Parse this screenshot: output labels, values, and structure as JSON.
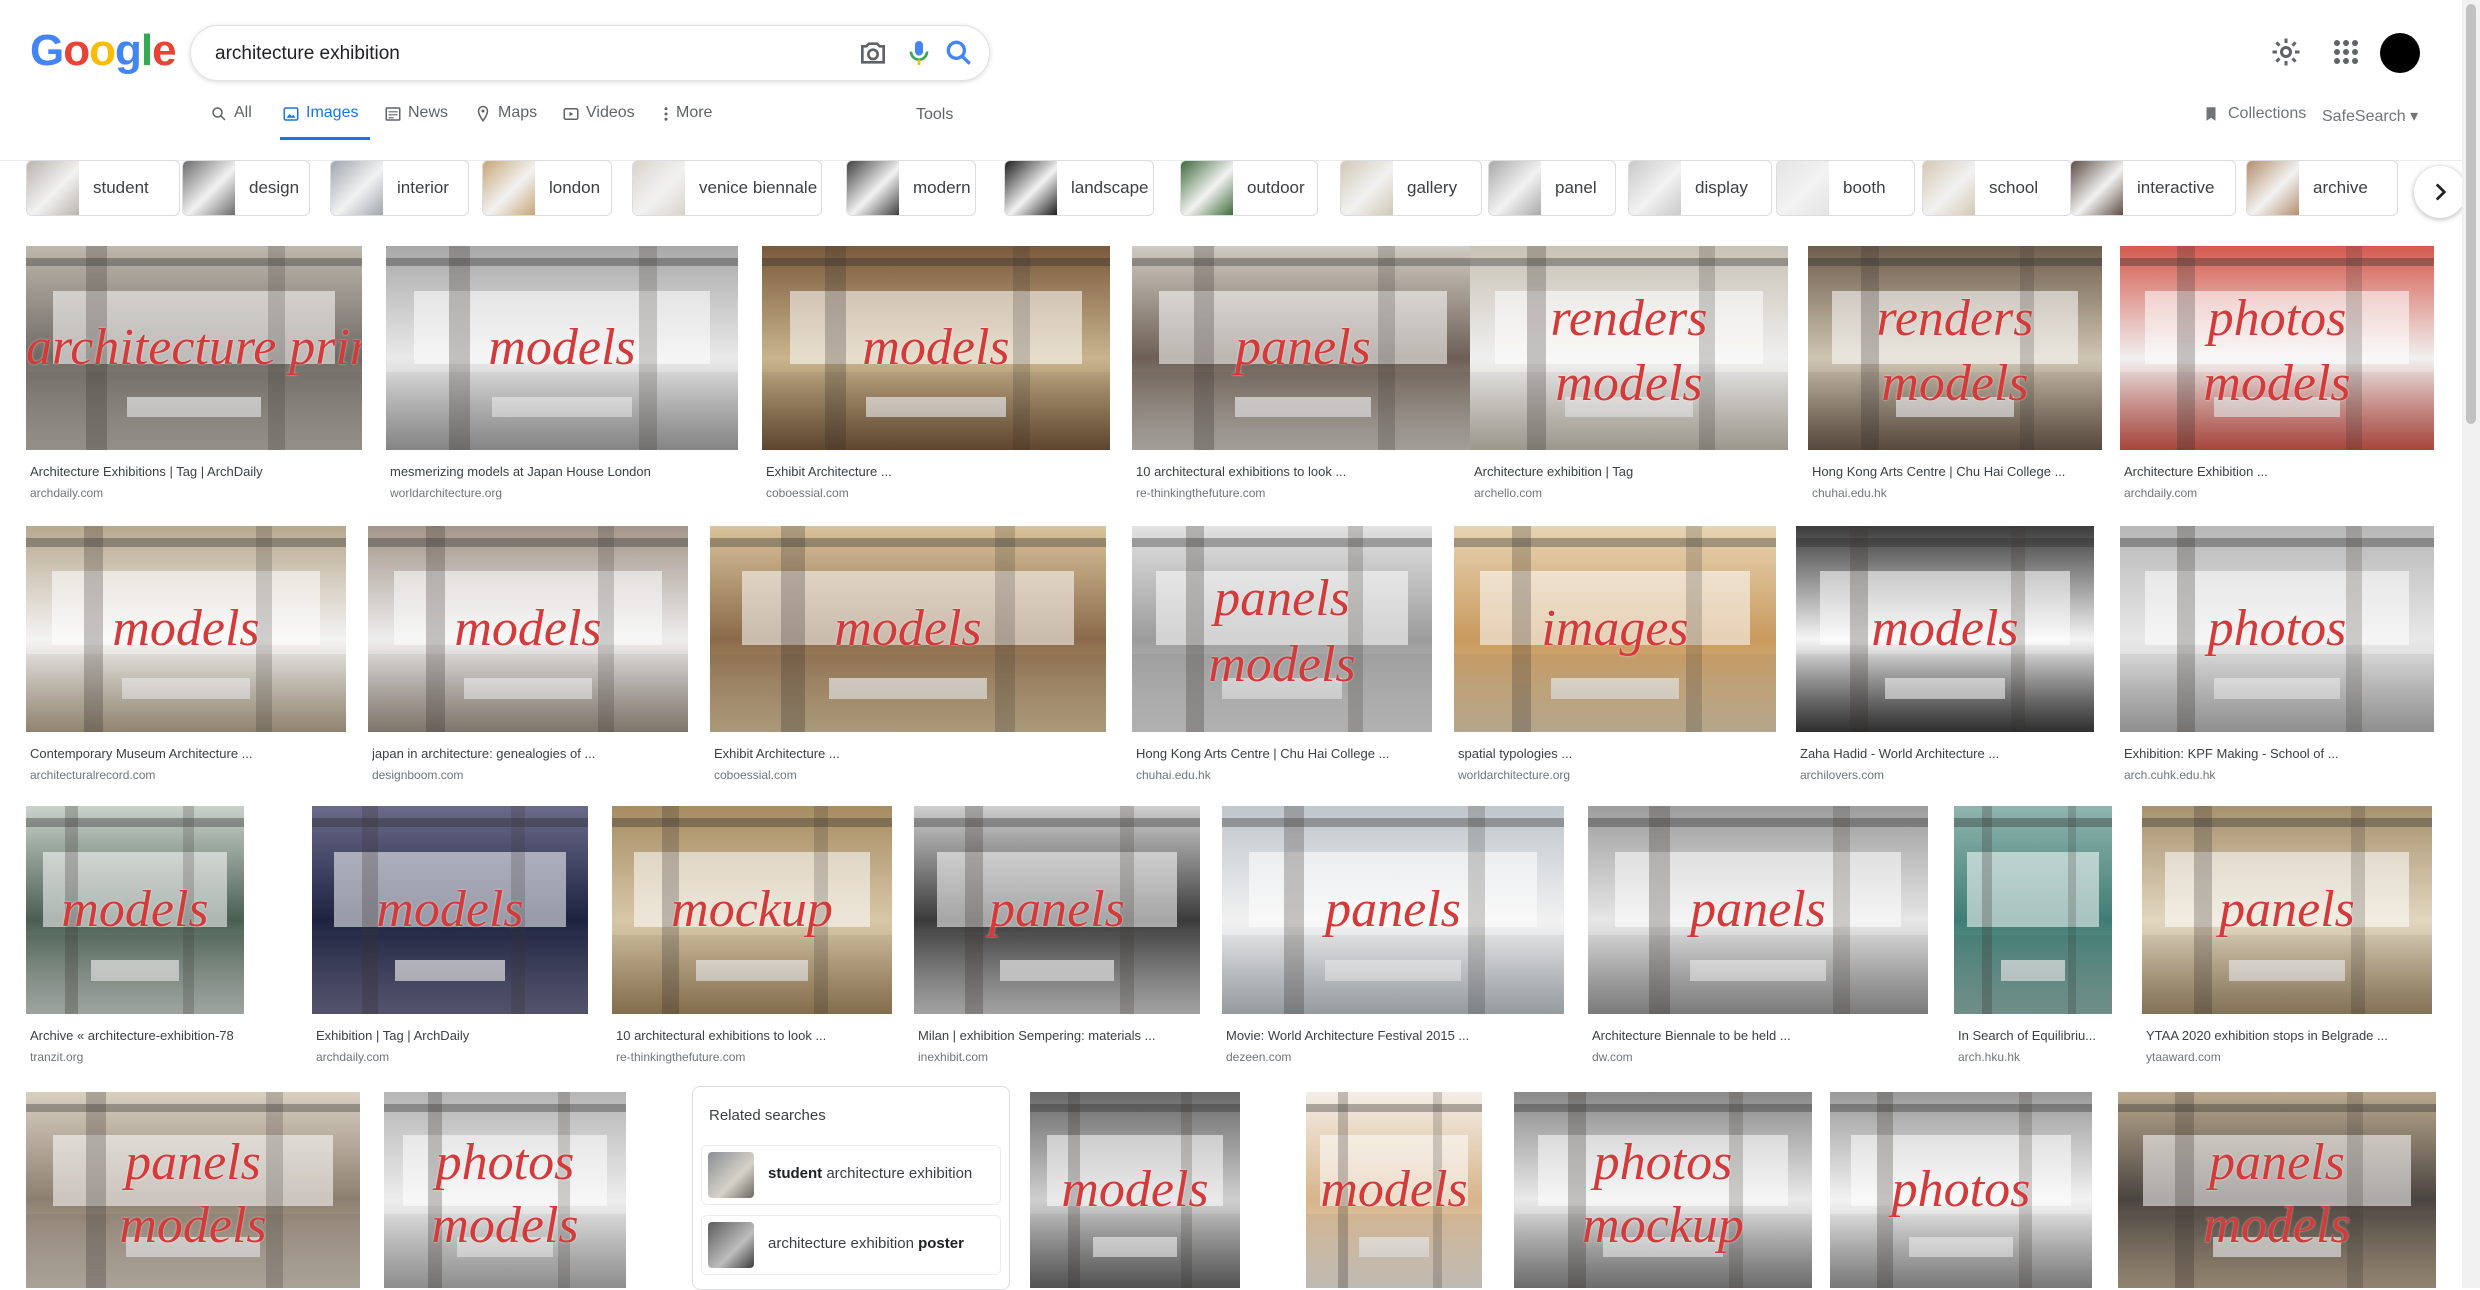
{
  "logo": {
    "text": "Google",
    "colors": [
      "#4285f4",
      "#ea4335",
      "#fbbc05",
      "#4285f4",
      "#34a853",
      "#ea4335"
    ]
  },
  "search": {
    "value": "architecture exhibition"
  },
  "icons": {
    "camera": "camera-icon",
    "mic": "mic-icon",
    "search": "search-icon",
    "settings": "gear-icon",
    "apps": "apps-grid-icon"
  },
  "tabs": [
    {
      "label": "All",
      "icon": "search-icon"
    },
    {
      "label": "Images",
      "icon": "images-icon"
    },
    {
      "label": "News",
      "icon": "news-icon"
    },
    {
      "label": "Maps",
      "icon": "map-pin-icon"
    },
    {
      "label": "Videos",
      "icon": "video-icon"
    },
    {
      "label": "More",
      "icon": "more-dots-icon"
    }
  ],
  "tools": "Tools",
  "collections": "Collections",
  "safesearch": "SafeSearch",
  "chips": [
    "student",
    "design",
    "interior",
    "london",
    "venice biennale",
    "modern",
    "landscape",
    "outdoor",
    "gallery",
    "panel",
    "display",
    "booth",
    "school",
    "interactive",
    "archive"
  ],
  "results": [
    {
      "title": "Architecture Exhibitions | Tag | ArchDaily",
      "site": "archdaily.com",
      "overlay": [
        "architecture prints"
      ]
    },
    {
      "title": "mesmerizing models at Japan House London",
      "site": "worldarchitecture.org",
      "overlay": [
        "models"
      ]
    },
    {
      "title": "Exhibit Architecture ...",
      "site": "coboessial.com",
      "overlay": [
        "models"
      ]
    },
    {
      "title": "10 architectural exhibitions to look ...",
      "site": "re-thinkingthefuture.com",
      "overlay": [
        "panels"
      ]
    },
    {
      "title": "Architecture exhibition | Tag",
      "site": "archello.com",
      "overlay": [
        "renders",
        "models"
      ]
    },
    {
      "title": "Hong Kong Arts Centre | Chu Hai College ...",
      "site": "chuhai.edu.hk",
      "overlay": [
        "renders",
        "models"
      ]
    },
    {
      "title": "Architecture Exhibition ...",
      "site": "archdaily.com",
      "overlay": [
        "photos",
        "models"
      ]
    },
    {
      "title": "Contemporary Museum Architecture ...",
      "site": "architecturalrecord.com",
      "overlay": [
        "models"
      ]
    },
    {
      "title": "japan in architecture: genealogies of ...",
      "site": "designboom.com",
      "overlay": [
        "models"
      ]
    },
    {
      "title": "Exhibit Architecture ...",
      "site": "coboessial.com",
      "overlay": [
        "models"
      ]
    },
    {
      "title": "Hong Kong Arts Centre | Chu Hai College ...",
      "site": "chuhai.edu.hk",
      "overlay": [
        "panels",
        "models"
      ]
    },
    {
      "title": "spatial typologies ...",
      "site": "worldarchitecture.org",
      "overlay": [
        "images"
      ]
    },
    {
      "title": "Zaha Hadid - World Architecture ...",
      "site": "archilovers.com",
      "overlay": [
        "models"
      ]
    },
    {
      "title": "Exhibition: KPF Making - School of ...",
      "site": "arch.cuhk.edu.hk",
      "overlay": [
        "photos"
      ]
    },
    {
      "title": "Archive « architecture-exhibition-78",
      "site": "tranzit.org",
      "overlay": [
        "models"
      ]
    },
    {
      "title": "Exhibition | Tag | ArchDaily",
      "site": "archdaily.com",
      "overlay": [
        "models"
      ]
    },
    {
      "title": "10 architectural exhibitions to look ...",
      "site": "re-thinkingthefuture.com",
      "overlay": [
        "mockup"
      ]
    },
    {
      "title": "Milan | exhibition Sempering: materials ...",
      "site": "inexhibit.com",
      "overlay": [
        "panels"
      ]
    },
    {
      "title": "Movie: World Architecture Festival 2015 ...",
      "site": "dezeen.com",
      "overlay": [
        "panels"
      ]
    },
    {
      "title": "Architecture Biennale to be held ...",
      "site": "dw.com",
      "overlay": [
        "panels"
      ]
    },
    {
      "title": "In Search of Equilibriu...",
      "site": "arch.hku.hk",
      "overlay": []
    },
    {
      "title": "YTAA 2020 exhibition stops in Belgrade ...",
      "site": "ytaaward.com",
      "overlay": [
        "panels"
      ]
    },
    {
      "title": "",
      "site": "",
      "overlay": [
        "panels",
        "models"
      ]
    },
    {
      "title": "",
      "site": "",
      "overlay": [
        "photos",
        "models"
      ]
    },
    {
      "title": "",
      "site": "",
      "overlay": [
        "models"
      ]
    },
    {
      "title": "",
      "site": "",
      "overlay": [
        "models"
      ]
    },
    {
      "title": "",
      "site": "",
      "overlay": [
        "photos",
        "mockup"
      ]
    },
    {
      "title": "",
      "site": "",
      "overlay": [
        "photos"
      ]
    },
    {
      "title": "",
      "site": "",
      "overlay": [
        "panels",
        "models"
      ]
    }
  ],
  "related": {
    "title": "Related searches",
    "items": [
      {
        "bold": "student",
        "rest": " architecture exhibition"
      },
      {
        "plain": "architecture exhibition ",
        "bold": "poster"
      }
    ]
  },
  "colors": {
    "accent": "#1a73e8",
    "overlay": "#d43a3a"
  }
}
